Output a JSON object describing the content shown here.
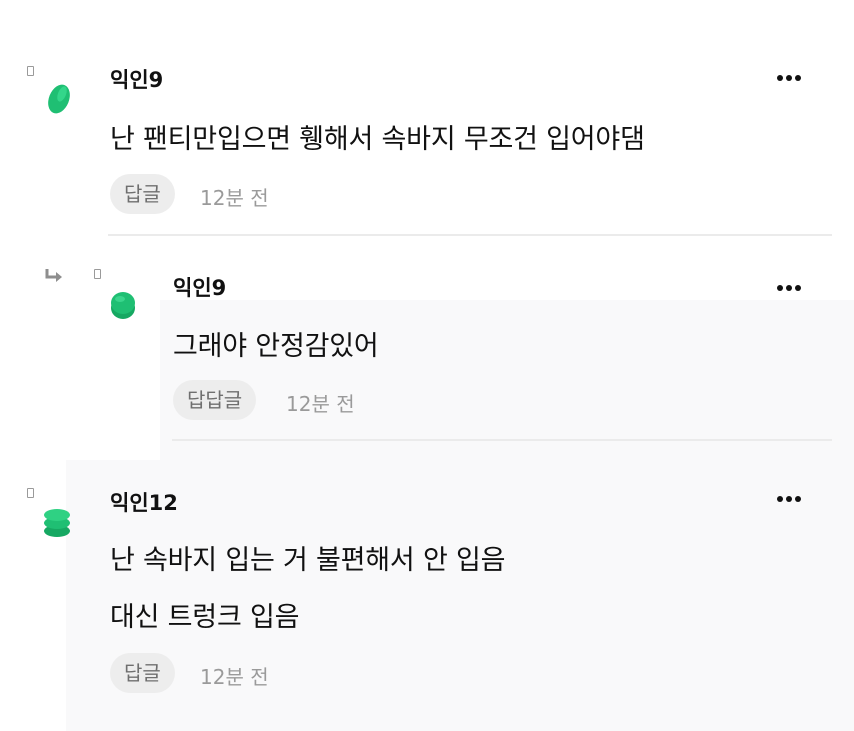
{
  "comments": [
    {
      "author": "익인9",
      "lines": [
        "난 팬티만입으면 휑해서 속바지 무조건 입어야댐"
      ],
      "reply_label": "답글",
      "time": "12분 전",
      "is_reply": false,
      "avatar_color": "#1fbf73",
      "avatar": "green-leaf-avatar"
    },
    {
      "author": "익인9",
      "lines": [
        "그래야 안정감있어"
      ],
      "reply_label": "답답글",
      "time": "12분 전",
      "is_reply": true,
      "avatar_color": "#1fbf73",
      "avatar": "green-stack-avatar"
    },
    {
      "author": "익인12",
      "lines": [
        "난 속바지 입는 거 불편해서 안 입음",
        "대신 트렁크 입음"
      ],
      "reply_label": "답글",
      "time": "12분 전",
      "is_reply": false,
      "avatar_color": "#1fbf73",
      "avatar": "green-coins-avatar"
    }
  ],
  "icons": {
    "more": "more-dots-icon",
    "fold": "fold-marker-icon",
    "reply_arrow": "reply-arrow-icon"
  },
  "colors": {
    "accent": "#1fbf73",
    "text": "#111111",
    "muted": "#9a9a9a",
    "chip_bg": "#ededed"
  }
}
